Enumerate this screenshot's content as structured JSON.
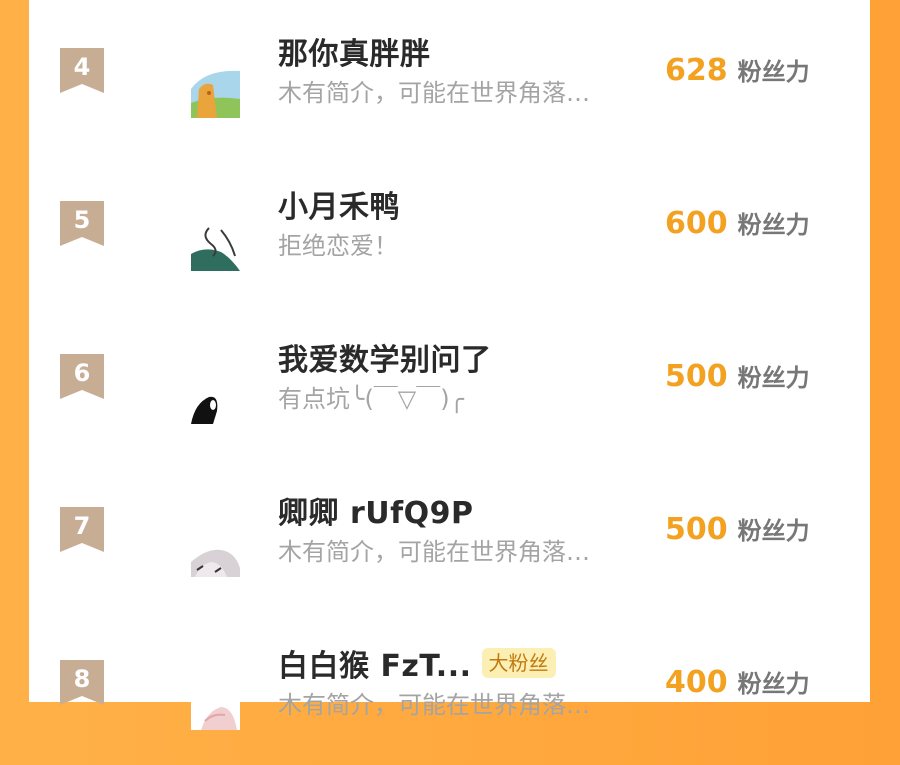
{
  "ranking": {
    "items": [
      {
        "rank": "4",
        "name": "那你真胖胖",
        "bio": "木有简介，可能在世界角落…",
        "score": "628",
        "unit": "粉丝力",
        "badge": "",
        "avatar_icon": "landscape-avatar-icon"
      },
      {
        "rank": "5",
        "name": "小月禾鸭",
        "bio": "拒绝恋爱！",
        "score": "600",
        "unit": "粉丝力",
        "badge": "",
        "avatar_icon": "character-avatar-icon"
      },
      {
        "rank": "6",
        "name": "我爱数学别问了",
        "bio": "有点坑╰(￣▽￣)╭",
        "score": "500",
        "unit": "粉丝力",
        "badge": "",
        "avatar_icon": "dark-figure-avatar-icon"
      },
      {
        "rank": "7",
        "name": "卿卿 rUfQ9P",
        "bio": "木有简介，可能在世界角落…",
        "score": "500",
        "unit": "粉丝力",
        "badge": "",
        "avatar_icon": "sketch-avatar-icon"
      },
      {
        "rank": "8",
        "name": "白白猴 FzT...",
        "bio": "木有简介，可能在世界角落…",
        "score": "400",
        "unit": "粉丝力",
        "badge": "大粉丝",
        "avatar_icon": "pink-avatar-icon"
      }
    ]
  },
  "colors": {
    "background_orange": "#ffa136",
    "rank_badge": "#c8ad95",
    "score": "#f3a120",
    "bio": "#a4a4a4",
    "badge_bg": "#fcefb4"
  }
}
